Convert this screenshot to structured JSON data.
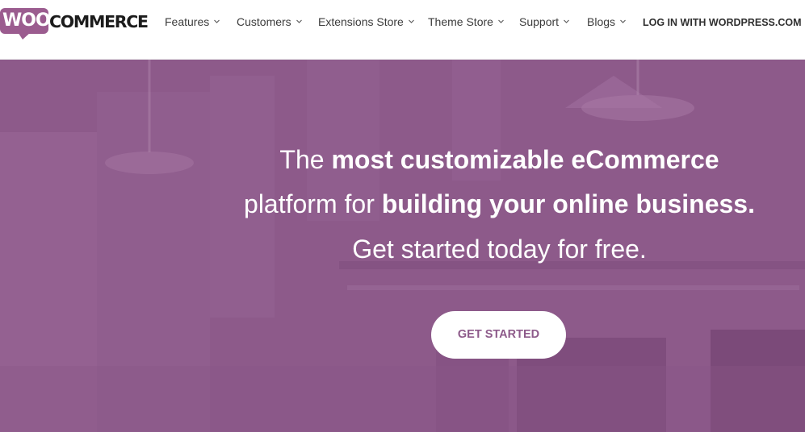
{
  "brand": {
    "logo_woo": "WOO",
    "logo_commerce": "COMMERCE",
    "colors": {
      "primary": "#9b5c8f",
      "hero_bg": "#8d5a8a",
      "text_dark": "#3c3c3c"
    }
  },
  "nav": {
    "items": [
      {
        "label": "Features",
        "icon": "chevron-down-icon"
      },
      {
        "label": "Customers",
        "icon": "chevron-down-icon"
      },
      {
        "label": "Extensions Store",
        "icon": "chevron-down-icon"
      },
      {
        "label": "Theme Store",
        "icon": "chevron-down-icon"
      },
      {
        "label": "Support",
        "icon": "chevron-down-icon"
      },
      {
        "label": "Blogs",
        "icon": "chevron-down-icon"
      }
    ],
    "login_label": "LOG IN WITH WORDPRESS.COM"
  },
  "hero": {
    "line1": {
      "normal": "The ",
      "bold": "most customizable eCommerce"
    },
    "line2": {
      "normal": "platform for ",
      "bold": "building your online business."
    },
    "line3": "Get started today for free.",
    "cta_label": "GET STARTED"
  }
}
